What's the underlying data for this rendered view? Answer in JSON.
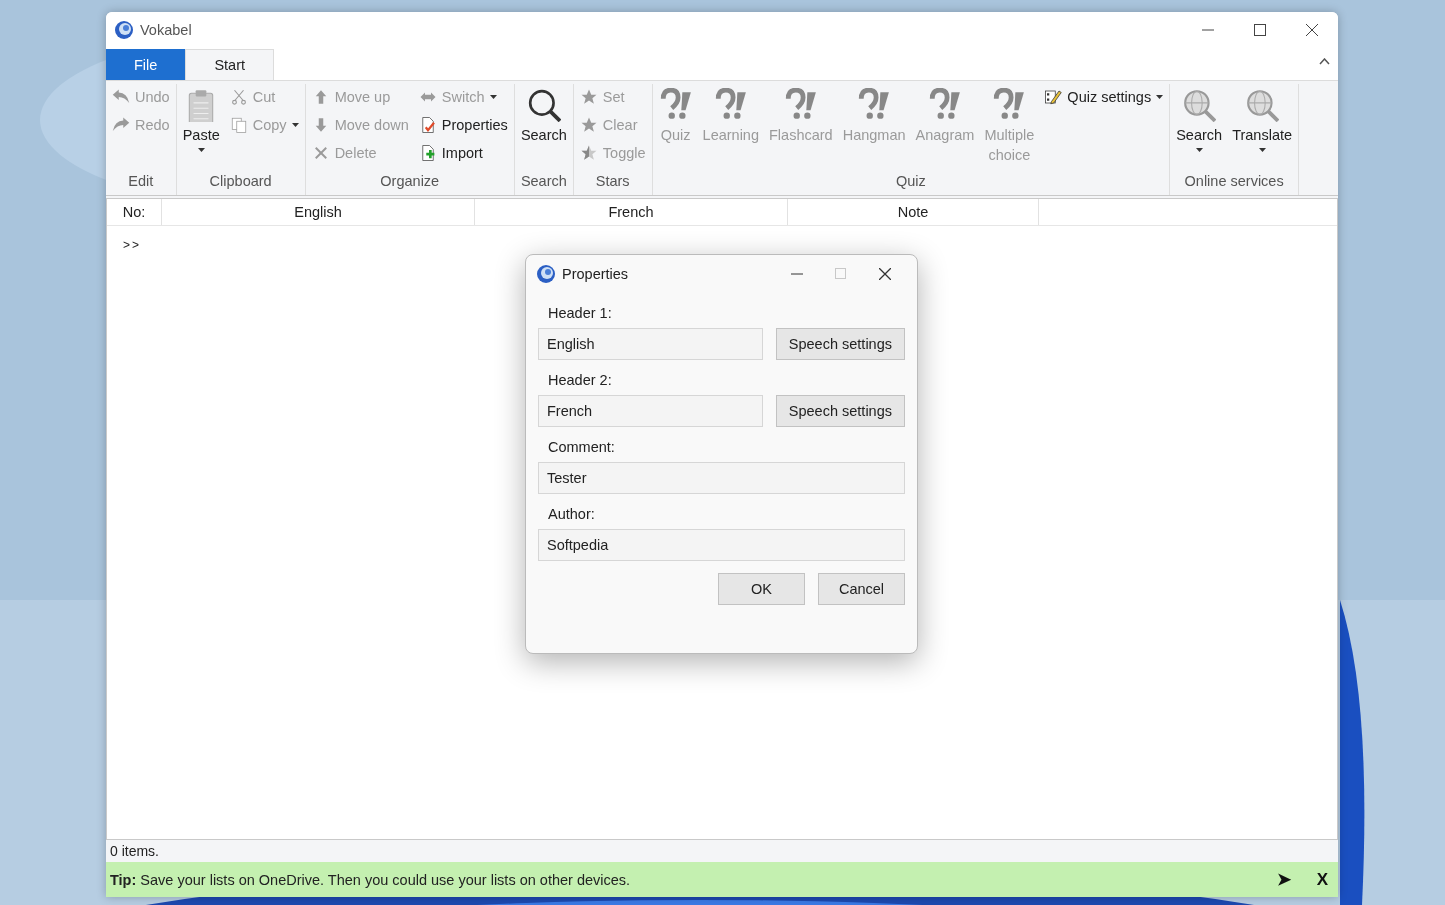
{
  "window": {
    "title": "Vokabel"
  },
  "tabs": [
    {
      "label": "File",
      "kind": "file",
      "selected": false
    },
    {
      "label": "Start",
      "kind": "tab",
      "selected": true
    }
  ],
  "ribbon": {
    "groups": [
      {
        "label": "Edit",
        "columns": [
          [
            {
              "label": "Undo",
              "kind": "small",
              "disabled": true
            },
            {
              "label": "Redo",
              "kind": "small",
              "disabled": true
            }
          ]
        ]
      },
      {
        "label": "Clipboard",
        "columns": [
          [
            {
              "label": "Paste",
              "kind": "large",
              "disabled": false,
              "dropdown": true
            }
          ],
          [
            {
              "label": "Cut",
              "kind": "small",
              "disabled": true
            },
            {
              "label": "Copy",
              "kind": "small",
              "disabled": true,
              "dropdown": true
            }
          ]
        ]
      },
      {
        "label": "Organize",
        "columns": [
          [
            {
              "label": "Move up",
              "kind": "small",
              "disabled": true
            },
            {
              "label": "Move down",
              "kind": "small",
              "disabled": true
            },
            {
              "label": "Delete",
              "kind": "small",
              "disabled": true
            }
          ],
          [
            {
              "label": "Switch",
              "kind": "small",
              "disabled": true,
              "dropdown": true
            },
            {
              "label": "Properties",
              "kind": "small",
              "disabled": false
            },
            {
              "label": "Import",
              "kind": "small",
              "disabled": false
            }
          ]
        ]
      },
      {
        "label": "Search",
        "columns": [
          [
            {
              "label": "Search",
              "kind": "large",
              "disabled": false
            }
          ]
        ]
      },
      {
        "label": "Stars",
        "columns": [
          [
            {
              "label": "Set",
              "kind": "small",
              "disabled": true
            },
            {
              "label": "Clear",
              "kind": "small",
              "disabled": true
            },
            {
              "label": "Toggle",
              "kind": "small",
              "disabled": true
            }
          ]
        ]
      },
      {
        "label": "Quiz",
        "columns": [
          [
            {
              "label": "Quiz",
              "kind": "large",
              "disabled": true
            }
          ],
          [
            {
              "label": "Learning",
              "kind": "large",
              "disabled": true
            }
          ],
          [
            {
              "label": "Flashcard",
              "kind": "large",
              "disabled": true
            }
          ],
          [
            {
              "label": "Hangman",
              "kind": "large",
              "disabled": true
            }
          ],
          [
            {
              "label": "Anagram",
              "kind": "large",
              "disabled": true
            }
          ],
          [
            {
              "label": "Multiple choice",
              "kind": "large",
              "disabled": true
            }
          ],
          [
            {
              "label": "Quiz settings",
              "kind": "small",
              "disabled": false,
              "dropdown": true
            }
          ]
        ]
      },
      {
        "label": "Online services",
        "columns": [
          [
            {
              "label": "Search",
              "kind": "large",
              "disabled": false,
              "dropdown": true
            }
          ],
          [
            {
              "label": "Translate",
              "kind": "large",
              "disabled": false,
              "dropdown": true
            }
          ]
        ]
      }
    ]
  },
  "table": {
    "columns": [
      "No:",
      "English",
      "French",
      "Note"
    ],
    "rows": [
      ">>"
    ]
  },
  "status_bar": "0 items.",
  "tip": {
    "text": "**Tip:** Save your lists on OneDrive. Then you could use your lists on other devices.",
    "arrow": "➤",
    "close": "X"
  },
  "dialog": {
    "title": "Properties",
    "maximize_disabled": true,
    "fields": [
      {
        "label": "Header 1:",
        "value": "English",
        "button": "Speech settings"
      },
      {
        "label": "Header 2:",
        "value": "French",
        "button": "Speech settings"
      },
      {
        "label": "Comment:",
        "value": "Tester"
      },
      {
        "label": "Author:",
        "value": "Softpedia"
      }
    ],
    "buttons": [
      "OK",
      "Cancel"
    ]
  }
}
